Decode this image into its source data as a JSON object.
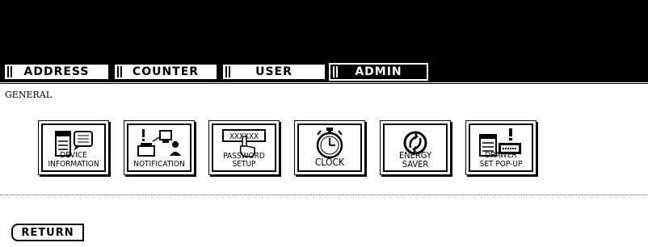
{
  "tabs": [
    {
      "label": "ADDRESS",
      "active": false
    },
    {
      "label": "COUNTER",
      "active": false
    },
    {
      "label": "USER",
      "active": false
    },
    {
      "label": "ADMIN",
      "active": true
    }
  ],
  "section": {
    "label": "GENERAL"
  },
  "buttons": [
    {
      "label": "DEVICE INFORMATION",
      "icon": "copier-info-icon"
    },
    {
      "label": "NOTIFICATION",
      "icon": "notification-icon"
    },
    {
      "label": "PASSWORD SETUP",
      "icon": "password-keypad-icon"
    },
    {
      "label": "CLOCK",
      "icon": "stopwatch-icon"
    },
    {
      "label": "ENERGY SAVER",
      "icon": "energy-saver-icon"
    },
    {
      "label": "DRAWER SET POP-UP",
      "icon": "drawer-alert-icon"
    }
  ],
  "icon_text": {
    "password": "XXXXXX"
  },
  "footer": {
    "return_label": "RETURN"
  }
}
